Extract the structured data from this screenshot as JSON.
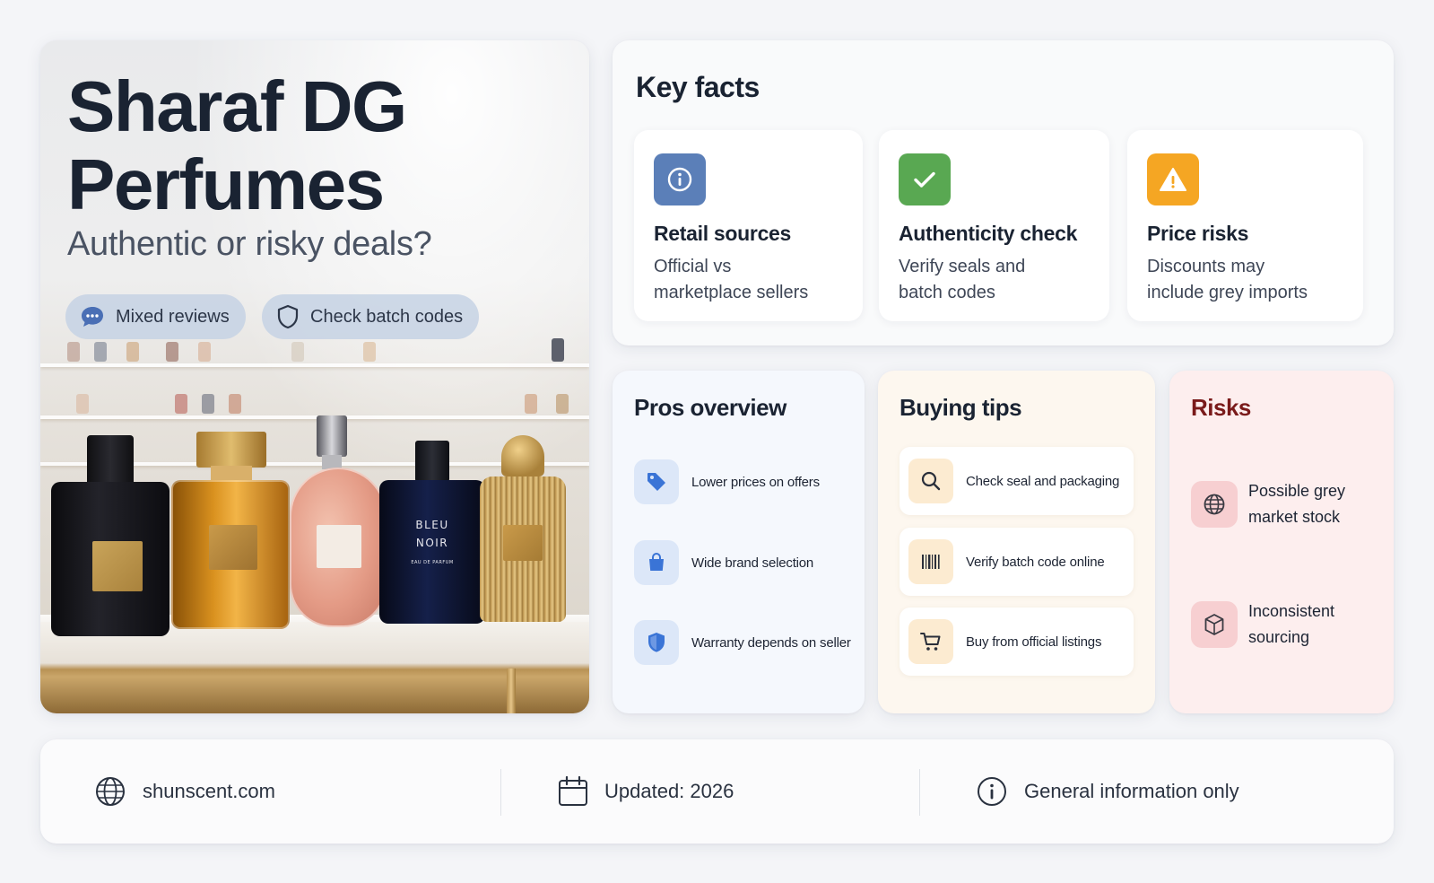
{
  "hero": {
    "title_line1": "Sharaf DG",
    "title_line2": "Perfumes",
    "subtitle": "Authentic or risky deals?",
    "pills": [
      {
        "label": "Mixed reviews",
        "icon": "chat-bubble-icon"
      },
      {
        "label": "Check batch codes",
        "icon": "shield-icon"
      }
    ],
    "bottle_label_line1": "BLEU",
    "bottle_label_line2": "NOIR",
    "bottle_label_line3": "EAU DE PARFUM"
  },
  "key_facts": {
    "title": "Key facts",
    "items": [
      {
        "title": "Retail sources",
        "desc_line1": "Official vs",
        "desc_line2": "marketplace sellers",
        "icon": "info-icon",
        "color": "#5b7fb8"
      },
      {
        "title": "Authenticity check",
        "desc_line1": "Verify seals and",
        "desc_line2": "batch codes",
        "icon": "check-icon",
        "color": "#59a852"
      },
      {
        "title": "Price risks",
        "desc_line1": "Discounts may",
        "desc_line2": "include grey imports",
        "icon": "warning-icon",
        "color": "#f5a623"
      }
    ]
  },
  "pros": {
    "title": "Pros overview",
    "items": [
      {
        "label": "Lower prices on offers",
        "icon": "price-tag-icon"
      },
      {
        "label": "Wide brand selection",
        "icon": "shopping-bag-icon"
      },
      {
        "label": "Warranty depends on seller",
        "icon": "shield-icon"
      }
    ]
  },
  "tips": {
    "title": "Buying tips",
    "items": [
      {
        "label": "Check seal and packaging",
        "icon": "search-icon"
      },
      {
        "label": "Verify batch code online",
        "icon": "barcode-icon"
      },
      {
        "label": "Buy from official listings",
        "icon": "cart-icon"
      }
    ]
  },
  "risks": {
    "title": "Risks",
    "title_color": "#7a1a1a",
    "items": [
      {
        "line1": "Possible grey",
        "line2": "market stock",
        "icon": "globe-icon"
      },
      {
        "line1": "Inconsistent",
        "line2": "sourcing",
        "icon": "box-icon"
      }
    ]
  },
  "footer": {
    "website": "shunscent.com",
    "updated": "Updated: 2026",
    "note": "General information only"
  }
}
